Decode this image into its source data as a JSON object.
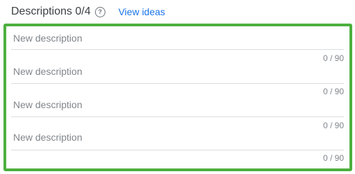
{
  "header": {
    "title": "Descriptions 0/4",
    "help_icon": "help-circle-icon",
    "view_ideas_label": "View ideas"
  },
  "fields": [
    {
      "placeholder": "New description",
      "value": "",
      "counter": "0 / 90"
    },
    {
      "placeholder": "New description",
      "value": "",
      "counter": "0 / 90"
    },
    {
      "placeholder": "New description",
      "value": "",
      "counter": "0 / 90"
    },
    {
      "placeholder": "New description",
      "value": "",
      "counter": "0 / 90"
    }
  ],
  "colors": {
    "highlight_frame": "#4caf3e",
    "link": "#1a73e8",
    "text": "#3c4043",
    "muted": "#80868b",
    "divider": "#dadce0"
  }
}
